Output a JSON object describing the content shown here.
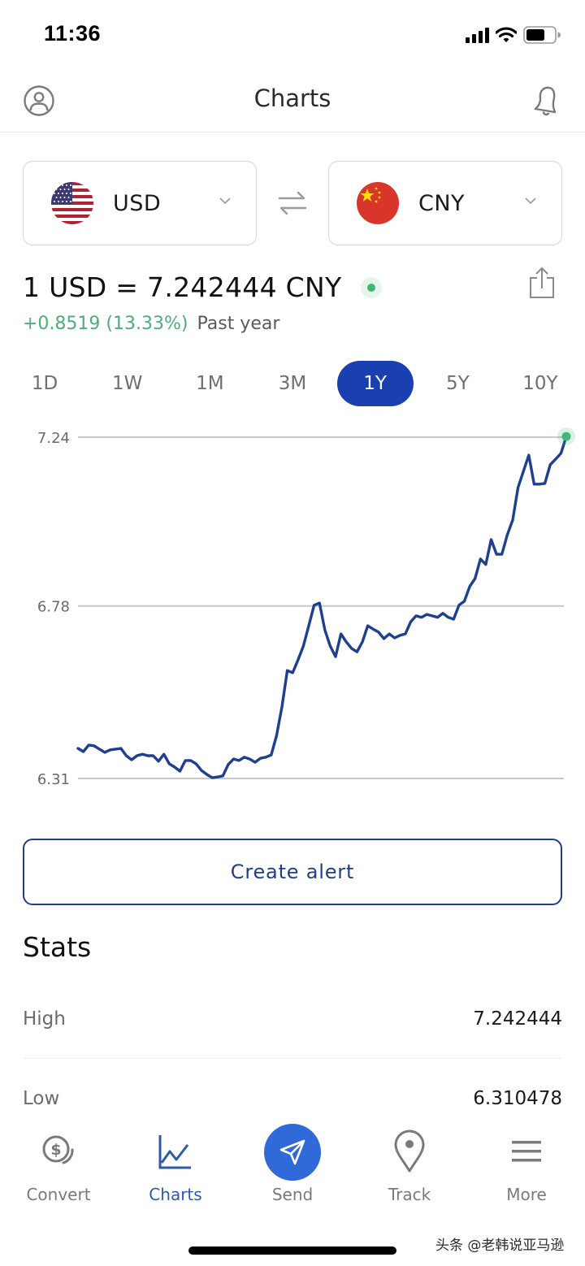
{
  "status_bar": {
    "time": "11:36"
  },
  "header": {
    "title": "Charts",
    "profile_icon": "user-circle-icon",
    "bell_icon": "bell-icon"
  },
  "currency": {
    "from": {
      "code": "USD",
      "flag": "us-flag-icon"
    },
    "to": {
      "code": "CNY",
      "flag": "cn-flag-icon"
    },
    "swap_icon": "swap-arrows-icon"
  },
  "rate": {
    "text": "1 USD = 7.242444 CNY",
    "change": "+0.8519 (13.33%)",
    "period": "Past year",
    "live_color": "#3fb873",
    "share_icon": "share-icon"
  },
  "range_tabs": [
    {
      "label": "1D",
      "active": false
    },
    {
      "label": "1W",
      "active": false
    },
    {
      "label": "1M",
      "active": false
    },
    {
      "label": "3M",
      "active": false
    },
    {
      "label": "1Y",
      "active": true
    },
    {
      "label": "5Y",
      "active": false
    },
    {
      "label": "10Y",
      "active": false
    }
  ],
  "chart_data": {
    "type": "line",
    "title": "",
    "xlabel": "",
    "ylabel": "",
    "period": "1Y",
    "ylim": [
      6.31,
      7.24
    ],
    "yticks": [
      {
        "value": 7.24,
        "label": "7.24"
      },
      {
        "value": 6.78,
        "label": "6.78"
      },
      {
        "value": 6.31,
        "label": "6.31"
      }
    ],
    "grid": true,
    "line_color": "#1f3f8f",
    "endpoint_color": "#3fb873",
    "series": [
      {
        "name": "USD/CNY",
        "values": [
          6.392,
          6.383,
          6.401,
          6.399,
          6.39,
          6.381,
          6.388,
          6.39,
          6.392,
          6.372,
          6.361,
          6.372,
          6.376,
          6.372,
          6.372,
          6.357,
          6.376,
          6.35,
          6.341,
          6.33,
          6.359,
          6.359,
          6.35,
          6.332,
          6.321,
          6.312,
          6.314,
          6.317,
          6.348,
          6.363,
          6.359,
          6.368,
          6.363,
          6.354,
          6.365,
          6.368,
          6.374,
          6.427,
          6.505,
          6.604,
          6.598,
          6.633,
          6.671,
          6.726,
          6.782,
          6.788,
          6.715,
          6.671,
          6.642,
          6.704,
          6.682,
          6.664,
          6.655,
          6.682,
          6.726,
          6.717,
          6.709,
          6.691,
          6.704,
          6.693,
          6.7,
          6.704,
          6.737,
          6.753,
          6.749,
          6.757,
          6.753,
          6.749,
          6.76,
          6.749,
          6.744,
          6.782,
          6.793,
          6.833,
          6.855,
          6.908,
          6.893,
          6.961,
          6.921,
          6.921,
          6.974,
          7.014,
          7.103,
          7.147,
          7.191,
          7.112,
          7.112,
          7.114,
          7.165,
          7.18,
          7.196,
          7.242
        ]
      }
    ]
  },
  "create_alert": {
    "label": "Create alert"
  },
  "stats": {
    "title": "Stats",
    "rows": [
      {
        "label": "High",
        "value": "7.242444"
      },
      {
        "label": "Low",
        "value": "6.310478"
      }
    ]
  },
  "bottom_nav": [
    {
      "label": "Convert",
      "icon": "coins-dollar-icon",
      "active": false
    },
    {
      "label": "Charts",
      "icon": "line-chart-icon",
      "active": true
    },
    {
      "label": "Send",
      "icon": "paper-plane-icon",
      "active": false
    },
    {
      "label": "Track",
      "icon": "map-pin-icon",
      "active": false
    },
    {
      "label": "More",
      "icon": "menu-icon",
      "active": false
    }
  ],
  "watermark": "头条 @老韩说亚马逊"
}
